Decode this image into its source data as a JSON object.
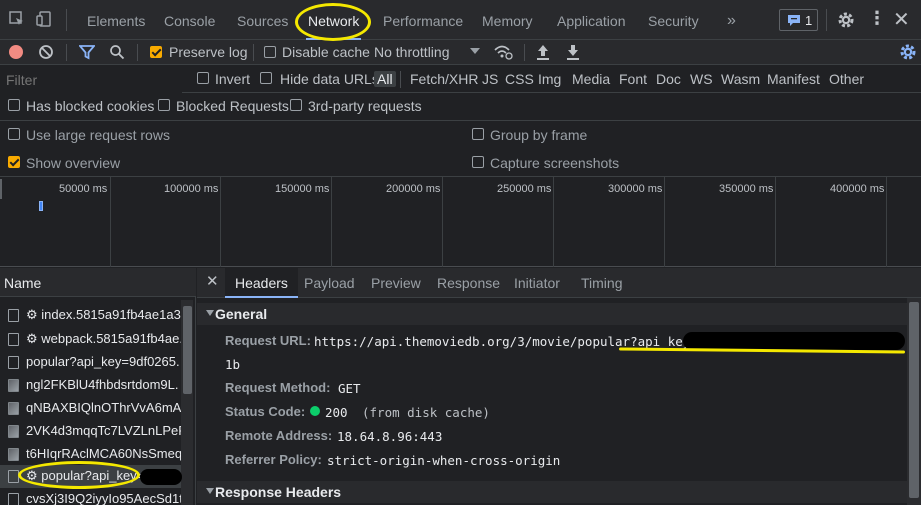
{
  "tabs": [
    {
      "label": "Elements"
    },
    {
      "label": "Console"
    },
    {
      "label": "Sources"
    },
    {
      "label": "Network"
    },
    {
      "label": "Performance"
    },
    {
      "label": "Memory"
    },
    {
      "label": "Application"
    },
    {
      "label": "Security"
    }
  ],
  "more_tabs": "»",
  "issues_count": "1",
  "toolbar": {
    "preserve_log": "Preserve log",
    "disable_cache": "Disable cache",
    "throttling": "No throttling"
  },
  "filter": {
    "placeholder": "Filter",
    "invert": "Invert",
    "hide_data_urls": "Hide data URLs",
    "types": [
      "All",
      "Fetch/XHR",
      "JS",
      "CSS",
      "Img",
      "Media",
      "Font",
      "Doc",
      "WS",
      "Wasm",
      "Manifest",
      "Other"
    ]
  },
  "filters2": {
    "blocked_cookies": "Has blocked cookies",
    "blocked_requests": "Blocked Requests",
    "third_party": "3rd-party requests"
  },
  "settings": {
    "large_rows": "Use large request rows",
    "group_by_frame": "Group by frame",
    "show_overview": "Show overview",
    "capture_screenshots": "Capture screenshots"
  },
  "overview_ticks": [
    "50000 ms",
    "100000 ms",
    "150000 ms",
    "200000 ms",
    "250000 ms",
    "300000 ms",
    "350000 ms",
    "400000 ms"
  ],
  "request_list": {
    "header": "Name",
    "items": [
      {
        "name": "index.5815a91fb4ae1a3"
      },
      {
        "name": "webpack.5815a91fb4ae."
      },
      {
        "name": "popular?api_key=9df0265."
      },
      {
        "name": "ngl2FKBlU4fhbdsrtdom9L."
      },
      {
        "name": "qNBAXBIQlnOThrVvA6mA"
      },
      {
        "name": "2VK4d3mqqTc7LVZLnLPeR"
      },
      {
        "name": "t6HIqrRAclMCA60NsSmeq"
      },
      {
        "name": "popular?api_key="
      },
      {
        "name": "cvsXj3I9Q2iyyIo95AecSd1t"
      }
    ]
  },
  "detail_tabs": [
    "Headers",
    "Payload",
    "Preview",
    "Response",
    "Initiator",
    "Timing"
  ],
  "general": {
    "title": "General",
    "request_url_label": "Request URL:",
    "request_url_value": "https://api.themoviedb.org/3/movie/popular?api_key=",
    "request_url_cont": "1b",
    "method_label": "Request Method:",
    "method_value": "GET",
    "status_label": "Status Code:",
    "status_value": "200",
    "status_note": "(from disk cache)",
    "remote_label": "Remote Address:",
    "remote_value": "18.64.8.96:443",
    "referrer_label": "Referrer Policy:",
    "referrer_value": "strict-origin-when-cross-origin"
  },
  "response_headers_title": "Response Headers",
  "colors": {
    "accent": "#8ab4f8",
    "highlight": "#f4e800",
    "checkbox": "#f9ab00",
    "record": "#f28b82"
  }
}
